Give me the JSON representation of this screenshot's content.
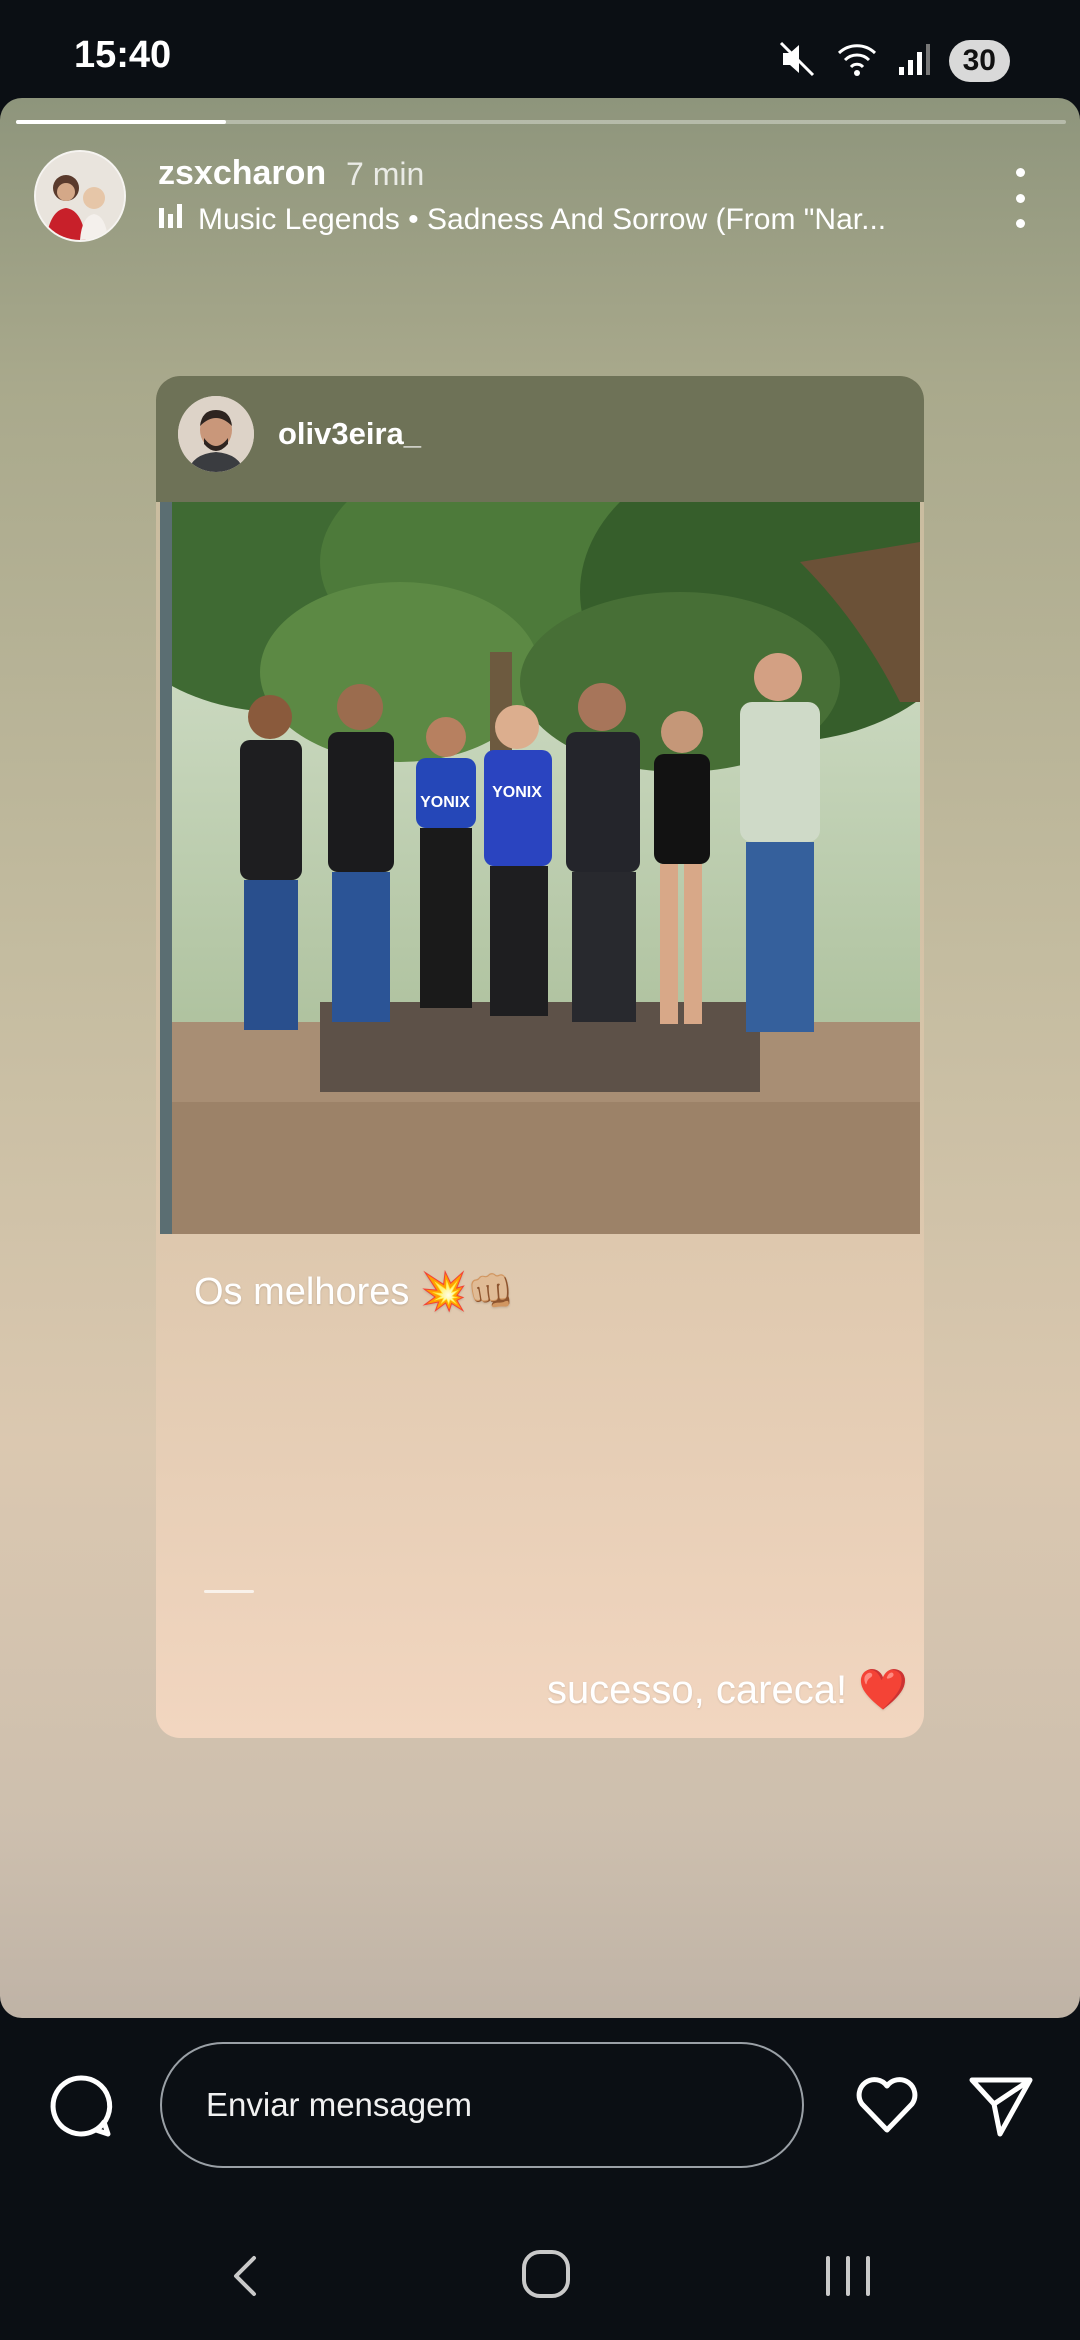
{
  "status_bar": {
    "time": "15:40",
    "battery": "30",
    "icons": [
      "mute-icon",
      "wifi-icon",
      "signal-icon"
    ]
  },
  "story": {
    "progress": 0.2,
    "username": "zsxcharon",
    "posted_time": "7 min",
    "music": "Music Legends • Sadness And Sorrow (From \"Nar..."
  },
  "post": {
    "username": "oliv3eira_",
    "caption_1": "Os melhores 💥👊🏼",
    "caption_2": "sucesso, careca! ❤️",
    "jersey_text": "YONIX"
  },
  "reply_bar": {
    "placeholder": "Enviar mensagem"
  },
  "colors": {
    "background": "#0b0f14",
    "post_header": "#6e7257"
  }
}
